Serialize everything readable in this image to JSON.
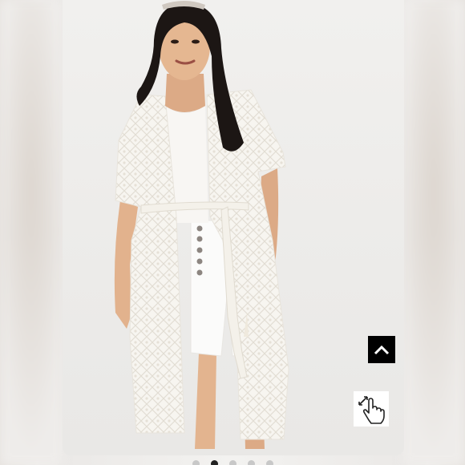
{
  "gallery": {
    "photo_alt": "",
    "slide_count": 5,
    "active_slide": 2
  },
  "icons": {
    "back_to_top": "chevron-up-icon",
    "zoom": "hand-pointer-expand-icon"
  },
  "colors": {
    "back_to_top_bg": "#000000",
    "active_dot": "#222222",
    "inactive_dot": "#c8c8c8"
  }
}
